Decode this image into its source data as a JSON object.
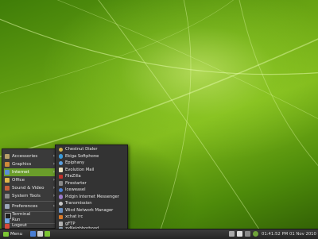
{
  "main_menu": {
    "items": [
      {
        "label": "Accessories",
        "icon": "accessories-icon",
        "has_submenu": true
      },
      {
        "label": "Graphics",
        "icon": "graphics-icon",
        "has_submenu": true
      },
      {
        "label": "Internet",
        "icon": "internet-icon",
        "has_submenu": true,
        "active": true
      },
      {
        "label": "Office",
        "icon": "office-icon",
        "has_submenu": true
      },
      {
        "label": "Sound & Video",
        "icon": "sound-video-icon",
        "has_submenu": true
      },
      {
        "label": "System Tools",
        "icon": "system-tools-icon",
        "has_submenu": true
      },
      {
        "label": "Preferences",
        "icon": "preferences-icon",
        "has_submenu": true
      },
      {
        "label": "Terminal",
        "icon": "terminal-icon",
        "has_submenu": false
      },
      {
        "label": "Run",
        "icon": "run-icon",
        "has_submenu": false
      },
      {
        "label": "Logout",
        "icon": "logout-icon",
        "has_submenu": false
      }
    ]
  },
  "internet_submenu": {
    "items": [
      {
        "label": "Chestnut Dialer",
        "icon": "dialer-icon"
      },
      {
        "label": "Ekiga Softphone",
        "icon": "softphone-icon"
      },
      {
        "label": "Epiphany",
        "icon": "epiphany-icon"
      },
      {
        "label": "Evolution Mail",
        "icon": "mail-icon"
      },
      {
        "label": "FileZilla",
        "icon": "filezilla-icon"
      },
      {
        "label": "Firestarter",
        "icon": "firestarter-icon"
      },
      {
        "label": "Iceweasel",
        "icon": "iceweasel-icon"
      },
      {
        "label": "Pidgin Internet Messenger",
        "icon": "pidgin-icon"
      },
      {
        "label": "Transmission",
        "icon": "transmission-icon"
      },
      {
        "label": "Wicd Network Manager",
        "icon": "network-manager-icon"
      },
      {
        "label": "xchat irc",
        "icon": "xchat-icon"
      },
      {
        "label": "gFTP",
        "icon": "gftp-icon"
      },
      {
        "label": "zyNeighborhood",
        "icon": "neighborhood-icon"
      }
    ]
  },
  "taskbar": {
    "menu_label": "Menu",
    "clock_time": "01:41:52 PM",
    "clock_date": "01 Nov 2010"
  },
  "colors": {
    "highlight": "#6a9d2a",
    "menu_bg": "#3a3a3a",
    "submenu_bg": "#333333"
  }
}
